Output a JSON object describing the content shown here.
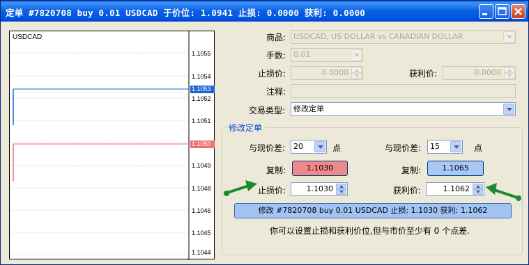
{
  "window": {
    "title": "定单 #7820708 buy 0.01 USDCAD 于价位: 1.0941 止损: 0.0000 获利: 0.0000",
    "controls": [
      "minimize-icon",
      "maximize-icon",
      "close-icon"
    ]
  },
  "chart": {
    "symbol": "USDCAD",
    "price_ticks": [
      "1.1055",
      "1.1054",
      "1.1052",
      "1.1051",
      "1.1049",
      "1.1048",
      "1.1046",
      "1.1045",
      "1.1044"
    ],
    "take_profit_tag": "1.1053",
    "stop_loss_tag": "1.1050",
    "colors": {
      "take_profit_line": "#1E66D6",
      "stop_loss_line": "#F07070"
    }
  },
  "form": {
    "symbol_label": "商品:",
    "symbol_value": "USDCAD, US DOLLAR vs CANADIAN DOLLAR",
    "volume_label": "手数:",
    "volume_value": "0.01",
    "stop_loss_label": "止损价:",
    "stop_loss_value": "0.0000",
    "take_profit_label": "获利价:",
    "take_profit_value": "0.0000",
    "comment_label": "注释:",
    "comment_value": "",
    "type_label": "交易类型:",
    "type_value": "修改定单"
  },
  "modify": {
    "group_title": "修改定单",
    "left": {
      "diff_label": "与现价差:",
      "diff_value": "20",
      "points_label": "点",
      "copy_label": "复制:",
      "copy_value": "1.1030",
      "price_label": "止损价:",
      "price_value": "1.1030"
    },
    "right": {
      "diff_label": "与现价差:",
      "diff_value": "15",
      "points_label": "点",
      "copy_label": "复制:",
      "copy_value": "1.1065",
      "price_label": "获利价:",
      "price_value": "1.1062"
    },
    "modify_button": "修改 #7820708 buy 0.01 USDCAD 止损: 1.1030 获利: 1.1062",
    "hint": "你可以设置止损和获利价位,但与市价至少有 0 个点差.",
    "arrow_color": "#1E8A2E"
  }
}
